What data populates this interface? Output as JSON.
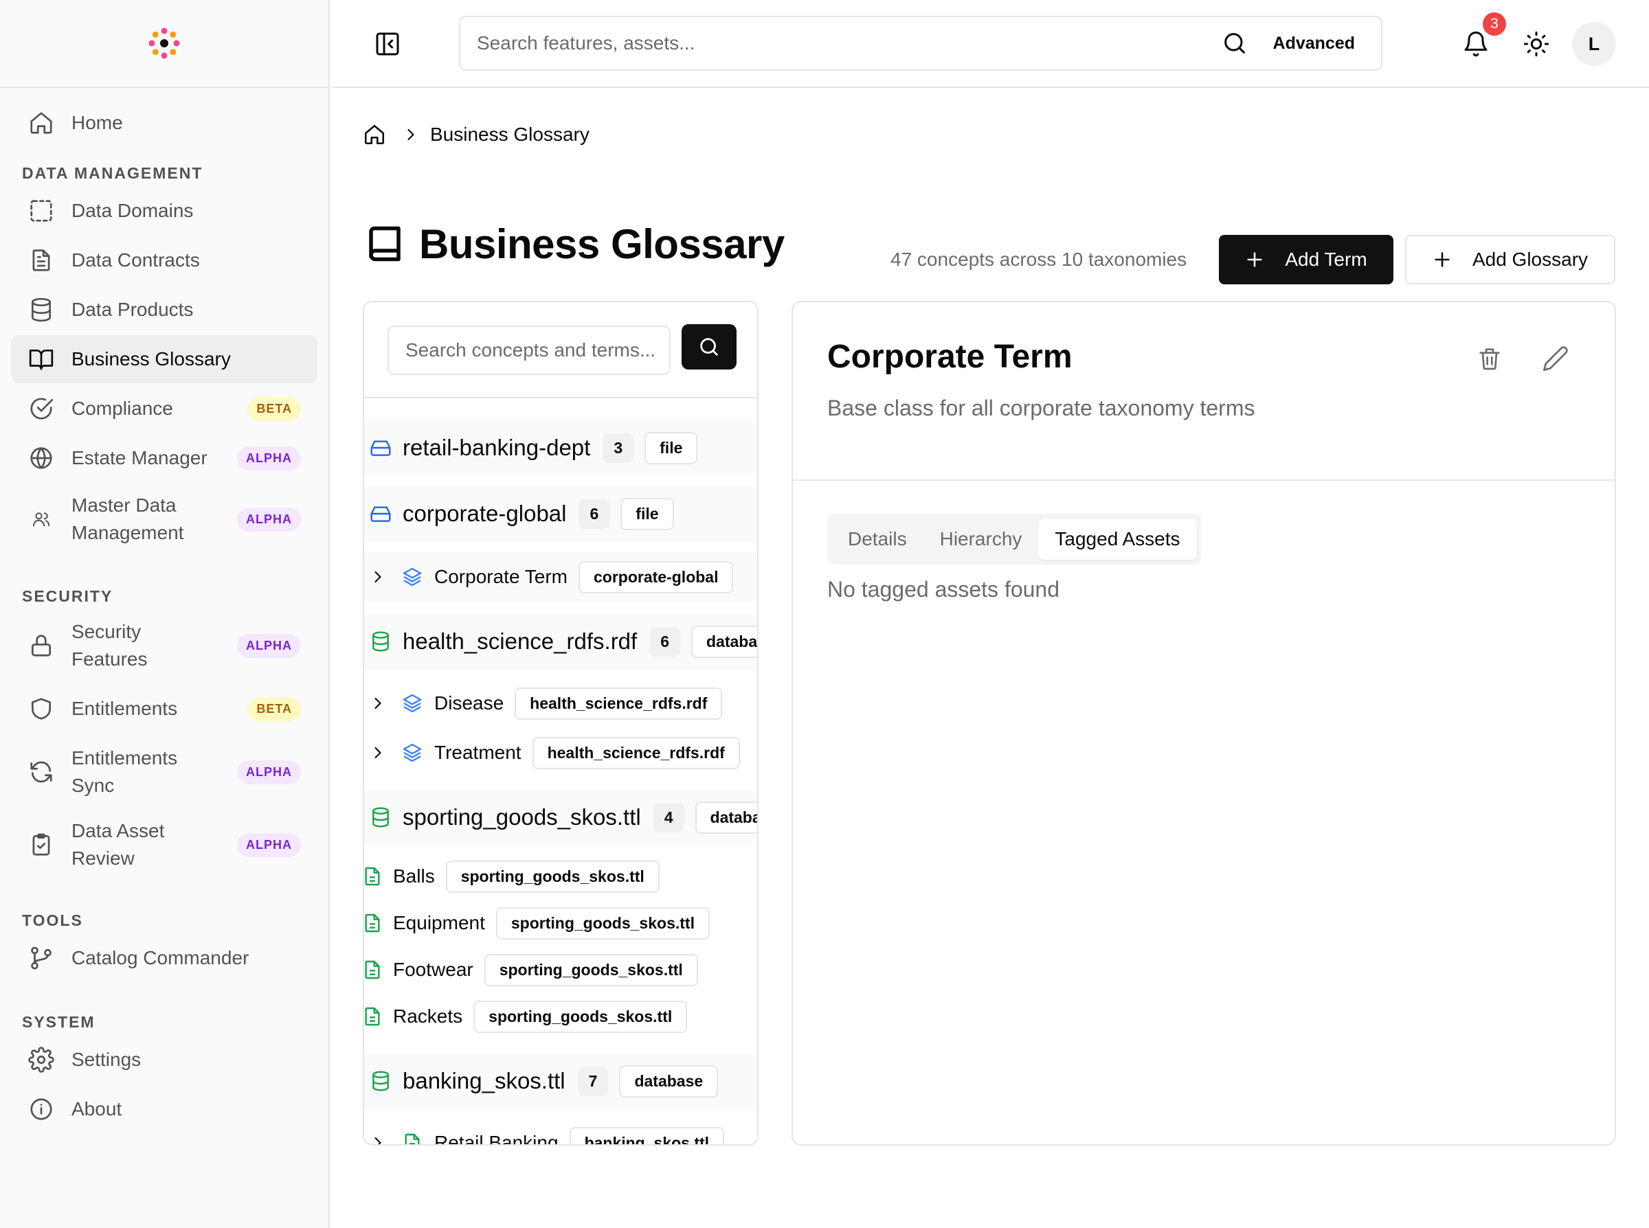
{
  "header": {
    "search_placeholder": "Search features, assets...",
    "advanced_label": "Advanced",
    "notification_count": "3",
    "avatar_initial": "L"
  },
  "sidebar": {
    "home": "Home",
    "sections": {
      "data_management": "DATA MANAGEMENT",
      "security": "SECURITY",
      "tools": "TOOLS",
      "system": "SYSTEM"
    },
    "data_management_items": [
      {
        "label": "Data Domains",
        "icon": "dashed-square-icon"
      },
      {
        "label": "Data Contracts",
        "icon": "document-icon"
      },
      {
        "label": "Data Products",
        "icon": "database-icon"
      },
      {
        "label": "Business Glossary",
        "icon": "book-open-icon",
        "active": true
      },
      {
        "label": "Compliance",
        "icon": "check-circle-icon",
        "badge": "BETA"
      },
      {
        "label": "Estate Manager",
        "icon": "globe-icon",
        "badge": "ALPHA"
      },
      {
        "label": "Master Data Management",
        "icon": "users-icon",
        "badge": "ALPHA"
      }
    ],
    "security_items": [
      {
        "label": "Security Features",
        "icon": "lock-icon",
        "badge": "ALPHA"
      },
      {
        "label": "Entitlements",
        "icon": "shield-icon",
        "badge": "BETA"
      },
      {
        "label": "Entitlements Sync",
        "icon": "refresh-icon",
        "badge": "ALPHA"
      },
      {
        "label": "Data Asset Review",
        "icon": "clipboard-check-icon",
        "badge": "ALPHA"
      }
    ],
    "tools_items": [
      {
        "label": "Catalog Commander",
        "icon": "git-branch-icon"
      }
    ],
    "system_items": [
      {
        "label": "Settings",
        "icon": "gear-icon"
      },
      {
        "label": "About",
        "icon": "info-icon"
      }
    ]
  },
  "breadcrumb": {
    "current": "Business Glossary"
  },
  "page": {
    "title": "Business Glossary",
    "stats": "47 concepts across 10 taxonomies",
    "add_term_label": "Add Term",
    "add_glossary_label": "Add Glossary"
  },
  "tree": {
    "search_placeholder": "Search concepts and terms...",
    "groups": [
      {
        "name": "retail-banking-dept",
        "count": "3",
        "type": "file"
      },
      {
        "name": "corporate-global",
        "count": "6",
        "type": "file"
      },
      {
        "name": "health_science_rdfs.rdf",
        "count": "6",
        "type": "database"
      },
      {
        "name": "sporting_goods_skos.ttl",
        "count": "4",
        "type": "database"
      },
      {
        "name": "banking_skos.ttl",
        "count": "7",
        "type": "database"
      }
    ],
    "terms": [
      {
        "name": "Corporate Term",
        "source": "corporate-global"
      },
      {
        "name": "Disease",
        "source": "health_science_rdfs.rdf"
      },
      {
        "name": "Treatment",
        "source": "health_science_rdfs.rdf"
      },
      {
        "name": "Balls",
        "source": "sporting_goods_skos.ttl"
      },
      {
        "name": "Equipment",
        "source": "sporting_goods_skos.ttl"
      },
      {
        "name": "Footwear",
        "source": "sporting_goods_skos.ttl"
      },
      {
        "name": "Rackets",
        "source": "sporting_goods_skos.ttl"
      },
      {
        "name": "Retail Banking",
        "source": "banking_skos.ttl"
      }
    ]
  },
  "detail": {
    "title": "Corporate Term",
    "description": "Base class for all corporate taxonomy terms",
    "tabs": [
      "Details",
      "Hierarchy",
      "Tagged Assets"
    ],
    "active_tab": "Tagged Assets",
    "empty_message": "No tagged assets found"
  },
  "colors": {
    "primary_button": "#111111",
    "notification_badge": "#ef4444",
    "beta_badge_bg": "#fef9c3",
    "beta_badge_text": "#a16207",
    "alpha_badge_bg": "#f3e8ff",
    "alpha_badge_text": "#7e22ce",
    "file_icon": "#2563eb",
    "database_icon": "#16a34a",
    "concept_icon": "#3b82f6"
  }
}
